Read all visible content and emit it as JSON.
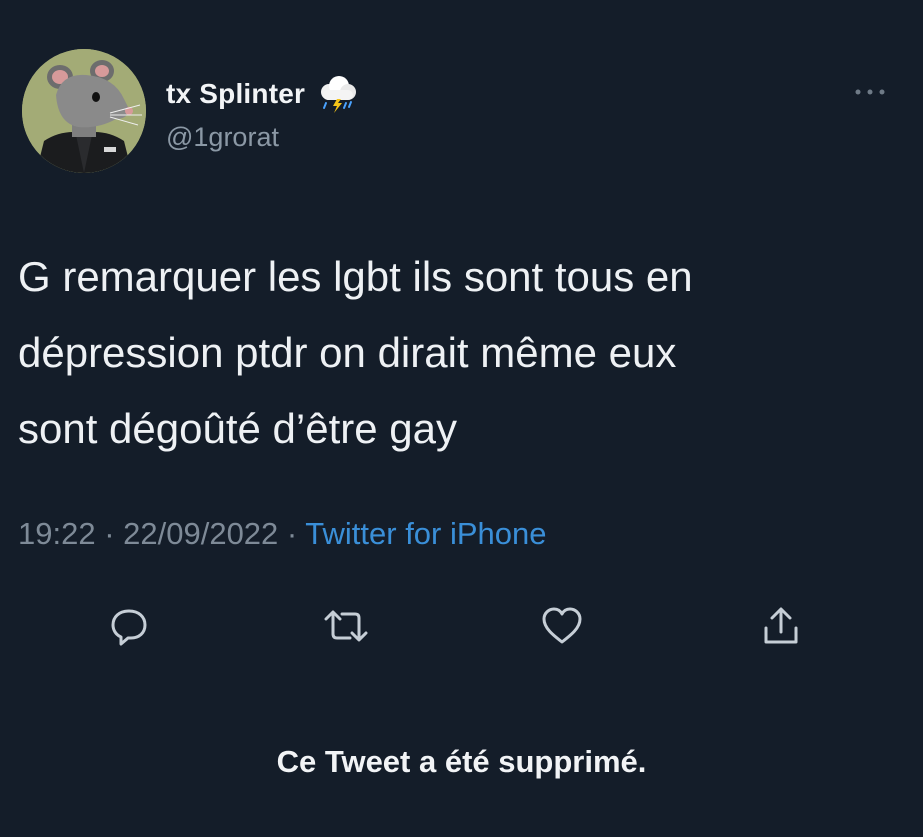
{
  "user": {
    "display_name": "tx Splinter",
    "handle": "@1grorat",
    "avatar_icon": "rat-avatar",
    "name_emoji_icon": "thunder-cloud-rain-icon"
  },
  "tweet": {
    "text": "G remarquer les lgbt ils sont tous en\ndépression ptdr on dirait même eux\nsont dégoûté d’être gay",
    "time": "19:22",
    "separator_1": " · ",
    "date": "22/09/2022",
    "separator_2": " · ",
    "source": "Twitter for iPhone"
  },
  "actions": [
    "reply-icon",
    "retweet-icon",
    "like-icon",
    "share-icon"
  ],
  "notice": "Ce Tweet a été supprimé.",
  "colors": {
    "background": "#141d29",
    "text": "#eef1f4",
    "muted": "#7e8a97",
    "link": "#3a8fd8"
  }
}
